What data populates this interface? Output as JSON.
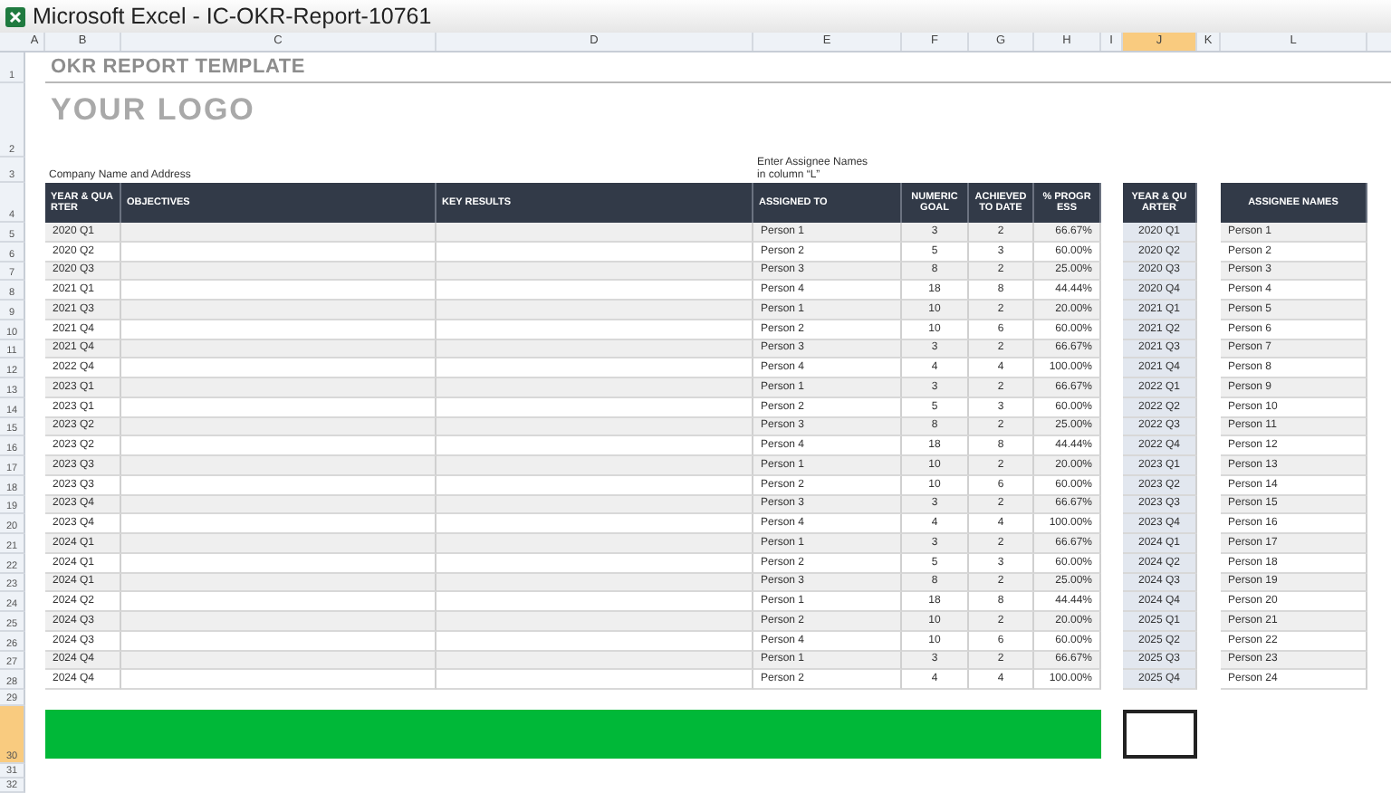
{
  "window": {
    "title": "Microsoft Excel - IC-OKR-Report-10761"
  },
  "column_headers": [
    {
      "label": "A",
      "selected": false
    },
    {
      "label": "B",
      "selected": false
    },
    {
      "label": "C",
      "selected": false
    },
    {
      "label": "D",
      "selected": false
    },
    {
      "label": "E",
      "selected": false
    },
    {
      "label": "F",
      "selected": false
    },
    {
      "label": "G",
      "selected": false
    },
    {
      "label": "H",
      "selected": false
    },
    {
      "label": "I",
      "selected": false
    },
    {
      "label": "J",
      "selected": true
    },
    {
      "label": "K",
      "selected": false
    },
    {
      "label": "L",
      "selected": false
    }
  ],
  "row_numbers": [
    {
      "label": "1",
      "selected": false
    },
    {
      "label": "2",
      "selected": false
    },
    {
      "label": "3",
      "selected": false
    },
    {
      "label": "4",
      "selected": false
    },
    {
      "label": "5",
      "selected": false
    },
    {
      "label": "6",
      "selected": false
    },
    {
      "label": "7",
      "selected": false
    },
    {
      "label": "8",
      "selected": false
    },
    {
      "label": "9",
      "selected": false
    },
    {
      "label": "10",
      "selected": false
    },
    {
      "label": "11",
      "selected": false
    },
    {
      "label": "12",
      "selected": false
    },
    {
      "label": "13",
      "selected": false
    },
    {
      "label": "14",
      "selected": false
    },
    {
      "label": "15",
      "selected": false
    },
    {
      "label": "16",
      "selected": false
    },
    {
      "label": "17",
      "selected": false
    },
    {
      "label": "18",
      "selected": false
    },
    {
      "label": "19",
      "selected": false
    },
    {
      "label": "20",
      "selected": false
    },
    {
      "label": "21",
      "selected": false
    },
    {
      "label": "22",
      "selected": false
    },
    {
      "label": "23",
      "selected": false
    },
    {
      "label": "24",
      "selected": false
    },
    {
      "label": "25",
      "selected": false
    },
    {
      "label": "26",
      "selected": false
    },
    {
      "label": "27",
      "selected": false
    },
    {
      "label": "28",
      "selected": false
    },
    {
      "label": "29",
      "selected": false
    },
    {
      "label": "30",
      "selected": true
    },
    {
      "label": "31",
      "selected": false
    },
    {
      "label": "32",
      "selected": false
    }
  ],
  "sheet": {
    "title": "OKR REPORT TEMPLATE",
    "logo": "YOUR LOGO",
    "company_label": "Company Name and Address",
    "assignee_note": "Enter Assignee Names\nin column “L”"
  },
  "table": {
    "columns": [
      "YEAR & QUARTER",
      "OBJECTIVES",
      "KEY RESULTS",
      "ASSIGNED TO",
      "NUMERIC GOAL",
      "ACHIEVED TO DATE",
      "% PROGRESS"
    ],
    "rows": [
      {
        "quarter": "2020 Q1",
        "assigned_to": "Person 1",
        "goal": "3",
        "achieved": "2",
        "progress": "66.67%"
      },
      {
        "quarter": "2020 Q2",
        "assigned_to": "Person 2",
        "goal": "5",
        "achieved": "3",
        "progress": "60.00%"
      },
      {
        "quarter": "2020 Q3",
        "assigned_to": "Person 3",
        "goal": "8",
        "achieved": "2",
        "progress": "25.00%"
      },
      {
        "quarter": "2021 Q1",
        "assigned_to": "Person 4",
        "goal": "18",
        "achieved": "8",
        "progress": "44.44%"
      },
      {
        "quarter": "2021 Q3",
        "assigned_to": "Person 1",
        "goal": "10",
        "achieved": "2",
        "progress": "20.00%"
      },
      {
        "quarter": "2021 Q4",
        "assigned_to": "Person 2",
        "goal": "10",
        "achieved": "6",
        "progress": "60.00%"
      },
      {
        "quarter": "2021 Q4",
        "assigned_to": "Person 3",
        "goal": "3",
        "achieved": "2",
        "progress": "66.67%"
      },
      {
        "quarter": "2022 Q4",
        "assigned_to": "Person 4",
        "goal": "4",
        "achieved": "4",
        "progress": "100.00%"
      },
      {
        "quarter": "2023 Q1",
        "assigned_to": "Person 1",
        "goal": "3",
        "achieved": "2",
        "progress": "66.67%"
      },
      {
        "quarter": "2023 Q1",
        "assigned_to": "Person 2",
        "goal": "5",
        "achieved": "3",
        "progress": "60.00%"
      },
      {
        "quarter": "2023 Q2",
        "assigned_to": "Person 3",
        "goal": "8",
        "achieved": "2",
        "progress": "25.00%"
      },
      {
        "quarter": "2023 Q2",
        "assigned_to": "Person 4",
        "goal": "18",
        "achieved": "8",
        "progress": "44.44%"
      },
      {
        "quarter": "2023 Q3",
        "assigned_to": "Person 1",
        "goal": "10",
        "achieved": "2",
        "progress": "20.00%"
      },
      {
        "quarter": "2023 Q3",
        "assigned_to": "Person 2",
        "goal": "10",
        "achieved": "6",
        "progress": "60.00%"
      },
      {
        "quarter": "2023 Q4",
        "assigned_to": "Person 3",
        "goal": "3",
        "achieved": "2",
        "progress": "66.67%"
      },
      {
        "quarter": "2023 Q4",
        "assigned_to": "Person 4",
        "goal": "4",
        "achieved": "4",
        "progress": "100.00%"
      },
      {
        "quarter": "2024 Q1",
        "assigned_to": "Person 1",
        "goal": "3",
        "achieved": "2",
        "progress": "66.67%"
      },
      {
        "quarter": "2024 Q1",
        "assigned_to": "Person 2",
        "goal": "5",
        "achieved": "3",
        "progress": "60.00%"
      },
      {
        "quarter": "2024 Q1",
        "assigned_to": "Person 3",
        "goal": "8",
        "achieved": "2",
        "progress": "25.00%"
      },
      {
        "quarter": "2024 Q2",
        "assigned_to": "Person 1",
        "goal": "18",
        "achieved": "8",
        "progress": "44.44%"
      },
      {
        "quarter": "2024 Q3",
        "assigned_to": "Person 2",
        "goal": "10",
        "achieved": "2",
        "progress": "20.00%"
      },
      {
        "quarter": "2024 Q3",
        "assigned_to": "Person 4",
        "goal": "10",
        "achieved": "6",
        "progress": "60.00%"
      },
      {
        "quarter": "2024 Q4",
        "assigned_to": "Person 1",
        "goal": "3",
        "achieved": "2",
        "progress": "66.67%"
      },
      {
        "quarter": "2024 Q4",
        "assigned_to": "Person 2",
        "goal": "4",
        "achieved": "4",
        "progress": "100.00%"
      }
    ]
  },
  "quarters": {
    "heading": "YEAR & QUARTER",
    "items": [
      "2020 Q1",
      "2020 Q2",
      "2020 Q3",
      "2020 Q4",
      "2021 Q1",
      "2021 Q2",
      "2021 Q3",
      "2021 Q4",
      "2022 Q1",
      "2022 Q2",
      "2022 Q3",
      "2022 Q4",
      "2023 Q1",
      "2023 Q2",
      "2023 Q3",
      "2023 Q4",
      "2024 Q1",
      "2024 Q2",
      "2024 Q3",
      "2024 Q4",
      "2025 Q1",
      "2025 Q2",
      "2025 Q3",
      "2025 Q4"
    ]
  },
  "assignees": {
    "heading": "ASSIGNEE NAMES",
    "items": [
      "Person 1",
      "Person 2",
      "Person 3",
      "Person 4",
      "Person 5",
      "Person 6",
      "Person 7",
      "Person 8",
      "Person 9",
      "Person 10",
      "Person 11",
      "Person 12",
      "Person 13",
      "Person 14",
      "Person 15",
      "Person 16",
      "Person 17",
      "Person 18",
      "Person 19",
      "Person 20",
      "Person 21",
      "Person 22",
      "Person 23",
      "Person 24"
    ]
  }
}
